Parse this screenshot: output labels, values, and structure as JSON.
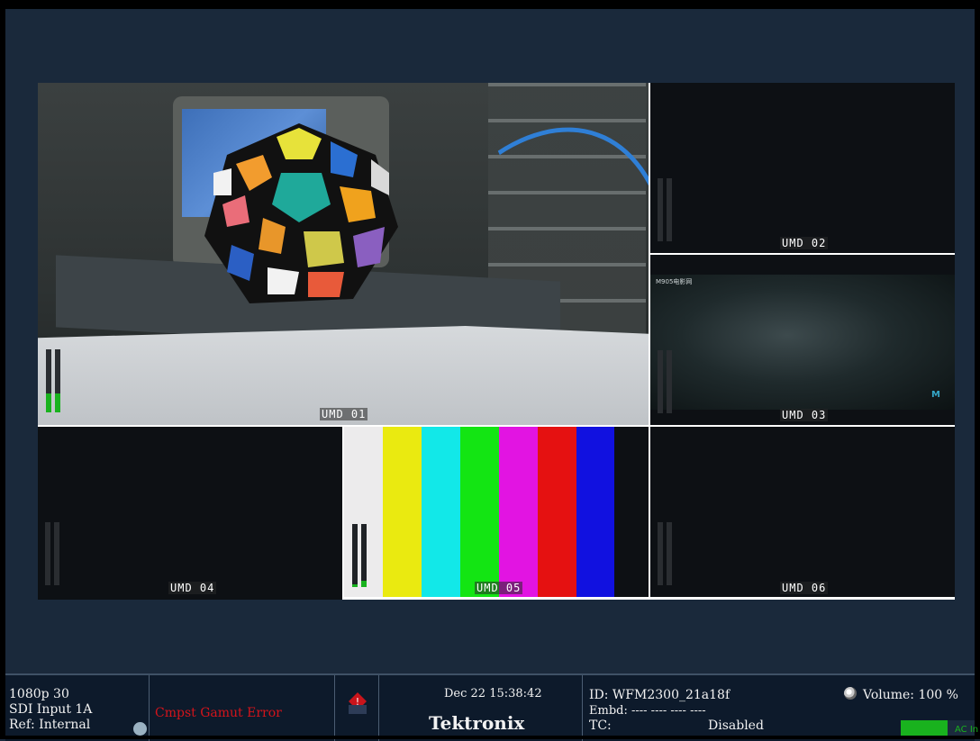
{
  "multiview": {
    "tiles": [
      {
        "umd": "UMD 01",
        "meters": [
          0.3,
          0.3
        ]
      },
      {
        "umd": "UMD 02",
        "meters": [
          0,
          0
        ]
      },
      {
        "umd": "UMD 03",
        "meters": [
          0,
          0
        ],
        "overlay_text": "M905电影网"
      },
      {
        "umd": "UMD 04",
        "meters": [
          0,
          0
        ]
      },
      {
        "umd": "UMD 05",
        "meters": [
          0.05,
          0.1
        ]
      },
      {
        "umd": "UMD 06",
        "meters": [
          0,
          0
        ]
      }
    ],
    "color_bars": [
      "#ecebec",
      "#eaea10",
      "#12e8e8",
      "#13e513",
      "#e214e2",
      "#e51111",
      "#1111e0",
      "#0d1014"
    ]
  },
  "status": {
    "format": "1080p 30",
    "input": "SDI Input 1A",
    "ref": "Ref: Internal",
    "error": "Cmpst Gamut Error",
    "datetime": "Dec 22 15:38:42",
    "brand": "Tektronix",
    "id": "ID: WFM2300_21a18f",
    "embd": "Embd: ---- ---- ---- ----",
    "tc_label": "TC:",
    "tc_value": "Disabled",
    "volume": "Volume: 100 %",
    "ac_label": "AC In"
  },
  "colors": {
    "background": "#1a293b",
    "meter_green": "#19b21e",
    "error_red": "#d4141b"
  }
}
